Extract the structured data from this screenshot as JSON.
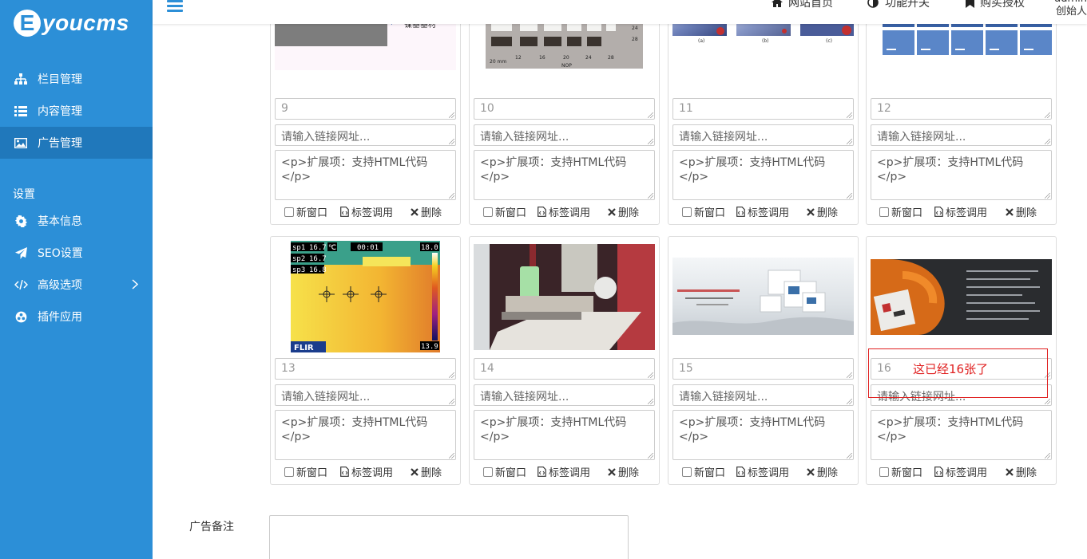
{
  "brand": {
    "logo_letter": "E",
    "logo_text": "youcms"
  },
  "sidebar": {
    "items": [
      {
        "label": "栏目管理",
        "icon": "sitemap-icon"
      },
      {
        "label": "内容管理",
        "icon": "list-icon"
      },
      {
        "label": "广告管理",
        "icon": "image-icon",
        "active": true
      }
    ],
    "section_title": "设置",
    "settings": [
      {
        "label": "基本信息",
        "icon": "gear-icon"
      },
      {
        "label": "SEO设置",
        "icon": "paper-plane-icon"
      },
      {
        "label": "高级选项",
        "icon": "code-icon",
        "has_arrow": true
      },
      {
        "label": "插件应用",
        "icon": "plugin-icon"
      }
    ]
  },
  "header": {
    "home": "网站首页",
    "features": "功能开关",
    "buy": "购买授权",
    "username": "admin",
    "role": "创始人"
  },
  "ad_form": {
    "link_placeholder": "请输入链接网址...",
    "extension_text": "<p>扩展项：支持HTML代码</p>",
    "new_window": "新窗口",
    "tag_call": "标签调用",
    "delete": "删除"
  },
  "ads": [
    {
      "order": "9",
      "image": "镍基基材"
    },
    {
      "order": "10",
      "image": "NOP"
    },
    {
      "order": "11",
      "image": ""
    },
    {
      "order": "12",
      "image": ""
    },
    {
      "order": "13",
      "image": "FLIR",
      "readings": [
        "sp1",
        "16.7",
        "sp2",
        "16.7",
        "sp3",
        "16.8",
        "℃",
        "00:01",
        "18.0",
        "13.9"
      ]
    },
    {
      "order": "14",
      "image": ""
    },
    {
      "order": "15",
      "image": ""
    },
    {
      "order": "16",
      "image": ""
    }
  ],
  "note": {
    "label": "广告备注"
  },
  "annotation": {
    "text": "这已经16张了",
    "color": "#e02020"
  },
  "colors": {
    "sidebar": "#2c8fd7",
    "sidebar_active": "#2078bb",
    "annotation": "#e02020"
  }
}
